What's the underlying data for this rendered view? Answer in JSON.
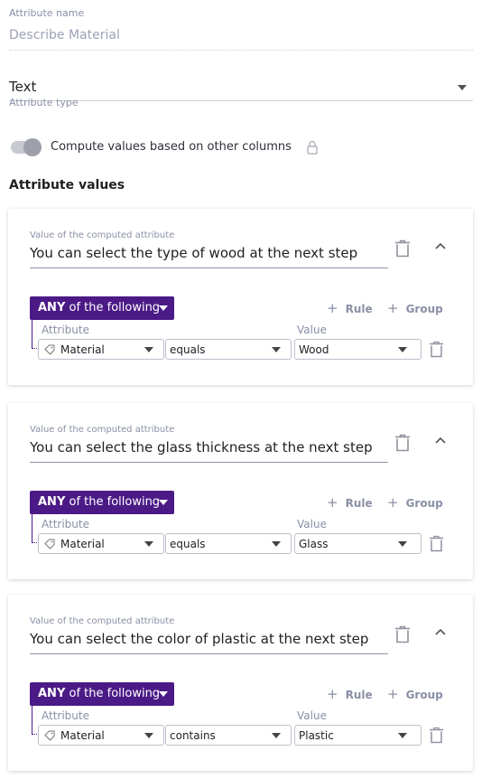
{
  "attribute_name": {
    "label": "Attribute name",
    "placeholder": "Describe Material"
  },
  "attribute_type": {
    "value": "Text",
    "label": "Attribute type"
  },
  "compute": {
    "label": "Compute values based on other columns",
    "enabled": false
  },
  "attribute_values": {
    "title": "Attribute values",
    "cards": [
      {
        "label": "Value of the computed attribute",
        "value": "You can select the type of wood at the next step",
        "any_strong": "ANY",
        "any_rest": " of the following",
        "add_rule": "Rule",
        "add_group": "Group",
        "attribute_col": "Attribute",
        "value_col": "Value",
        "attribute": "Material",
        "operator": "equals",
        "rule_value": "Wood"
      },
      {
        "label": "Value of the computed attribute",
        "value": "You can select the glass thickness at the next step",
        "any_strong": "ANY",
        "any_rest": " of the following",
        "add_rule": "Rule",
        "add_group": "Group",
        "attribute_col": "Attribute",
        "value_col": "Value",
        "attribute": "Material",
        "operator": "equals",
        "rule_value": "Glass"
      },
      {
        "label": "Value of the computed attribute",
        "value": "You can select the color of plastic at the next step",
        "any_strong": "ANY",
        "any_rest": " of the following",
        "add_rule": "Rule",
        "add_group": "Group",
        "attribute_col": "Attribute",
        "value_col": "Value",
        "attribute": "Material",
        "operator": "contains",
        "rule_value": "Plastic"
      }
    ]
  },
  "colors": {
    "accent": "#4b1a86",
    "muted": "#8a8fa6"
  }
}
